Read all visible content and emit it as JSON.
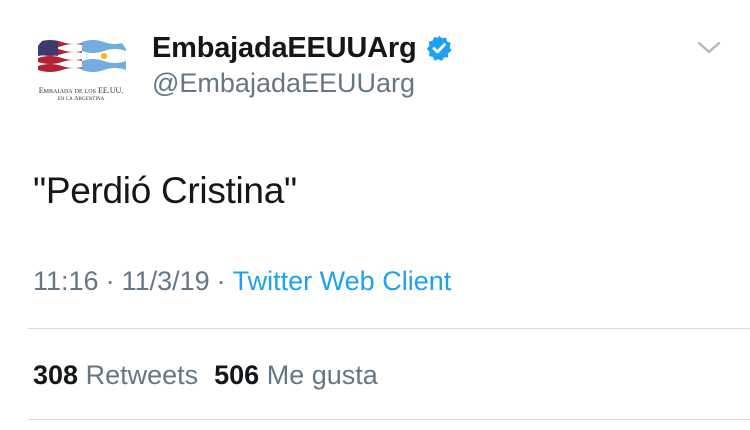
{
  "account": {
    "display_name": "EmbajadaEEUUArg",
    "handle": "@EmbajadaEEUUarg",
    "avatar_caption_line1": "Embajada de los EE.UU.",
    "avatar_caption_line2": "en la Argentina"
  },
  "tweet": {
    "text": "\"Perdió Cristina\""
  },
  "meta": {
    "time": "11:16",
    "separator": "·",
    "date": "11/3/19",
    "client": "Twitter Web Client"
  },
  "stats": {
    "retweets_count": "308",
    "retweets_label": "Retweets",
    "likes_count": "506",
    "likes_label": "Me gusta"
  },
  "icons": {
    "verified": "verified-badge-icon",
    "menu": "chevron-down-icon"
  },
  "colors": {
    "link": "#1da1f2",
    "secondary_text": "#657786",
    "primary_text": "#14171a",
    "divider": "#d9dde1"
  }
}
